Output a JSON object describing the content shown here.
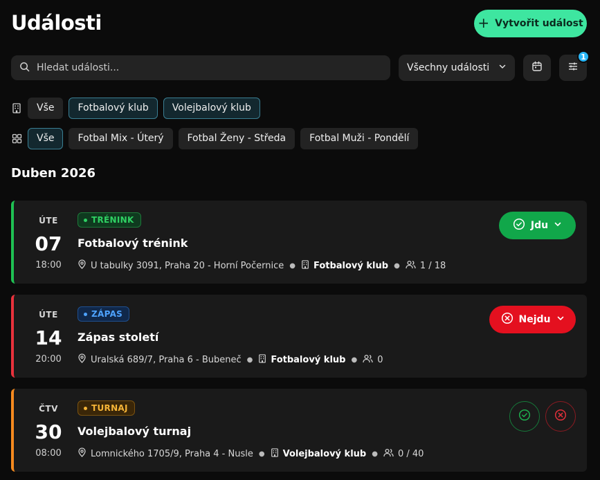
{
  "header": {
    "title": "Události",
    "create_label": "Vytvořit událost"
  },
  "toolbar": {
    "search_placeholder": "Hledat události...",
    "filter_select_value": "Všechny události",
    "filter_badge_count": "1"
  },
  "club_filters": {
    "items": [
      {
        "label": "Vše",
        "active": false
      },
      {
        "label": "Fotbalový klub",
        "active": true
      },
      {
        "label": "Volejbalový klub",
        "active": true
      }
    ]
  },
  "team_filters": {
    "items": [
      {
        "label": "Vše",
        "active": true
      },
      {
        "label": "Fotbal Mix - Úterý",
        "active": false
      },
      {
        "label": "Fotbal Ženy - Středa",
        "active": false
      },
      {
        "label": "Fotbal Muži - Pondělí",
        "active": false
      }
    ]
  },
  "month_heading": "Duben 2026",
  "events": [
    {
      "dow": "ÚTE",
      "day": "07",
      "time": "18:00",
      "tag": "TRÉNINK",
      "title": "Fotbalový trénink",
      "location": "U tabulky 3091, Praha 20 - Horní Počernice",
      "club": "Fotbalový klub",
      "attendance": "1 / 18",
      "rsvp_label": "Jdu",
      "colors": {
        "accent": "#1fc153",
        "tag_bg": "#0f3a1f",
        "tag_border": "#1e7a3a",
        "tag_text": "#2fd163"
      }
    },
    {
      "dow": "ÚTE",
      "day": "14",
      "time": "20:00",
      "tag": "ZÁPAS",
      "title": "Zápas století",
      "location": "Uralská 689/7, Praha 6 - Bubeneč",
      "club": "Fotbalový klub",
      "attendance": "0",
      "rsvp_label": "Nejdu",
      "colors": {
        "accent": "#e8323c",
        "tag_bg": "#10284a",
        "tag_border": "#1f4f8f",
        "tag_text": "#4ea3ff"
      }
    },
    {
      "dow": "ČTV",
      "day": "30",
      "time": "08:00",
      "tag": "TURNAJ",
      "title": "Volejbalový turnaj",
      "location": "Lomnického 1705/9, Praha 4 - Nusle",
      "club": "Volejbalový klub",
      "attendance": "0 / 40",
      "colors": {
        "accent": "#f58a1f",
        "tag_bg": "#3a2608",
        "tag_border": "#7a5210",
        "tag_text": "#f5b437"
      }
    }
  ]
}
